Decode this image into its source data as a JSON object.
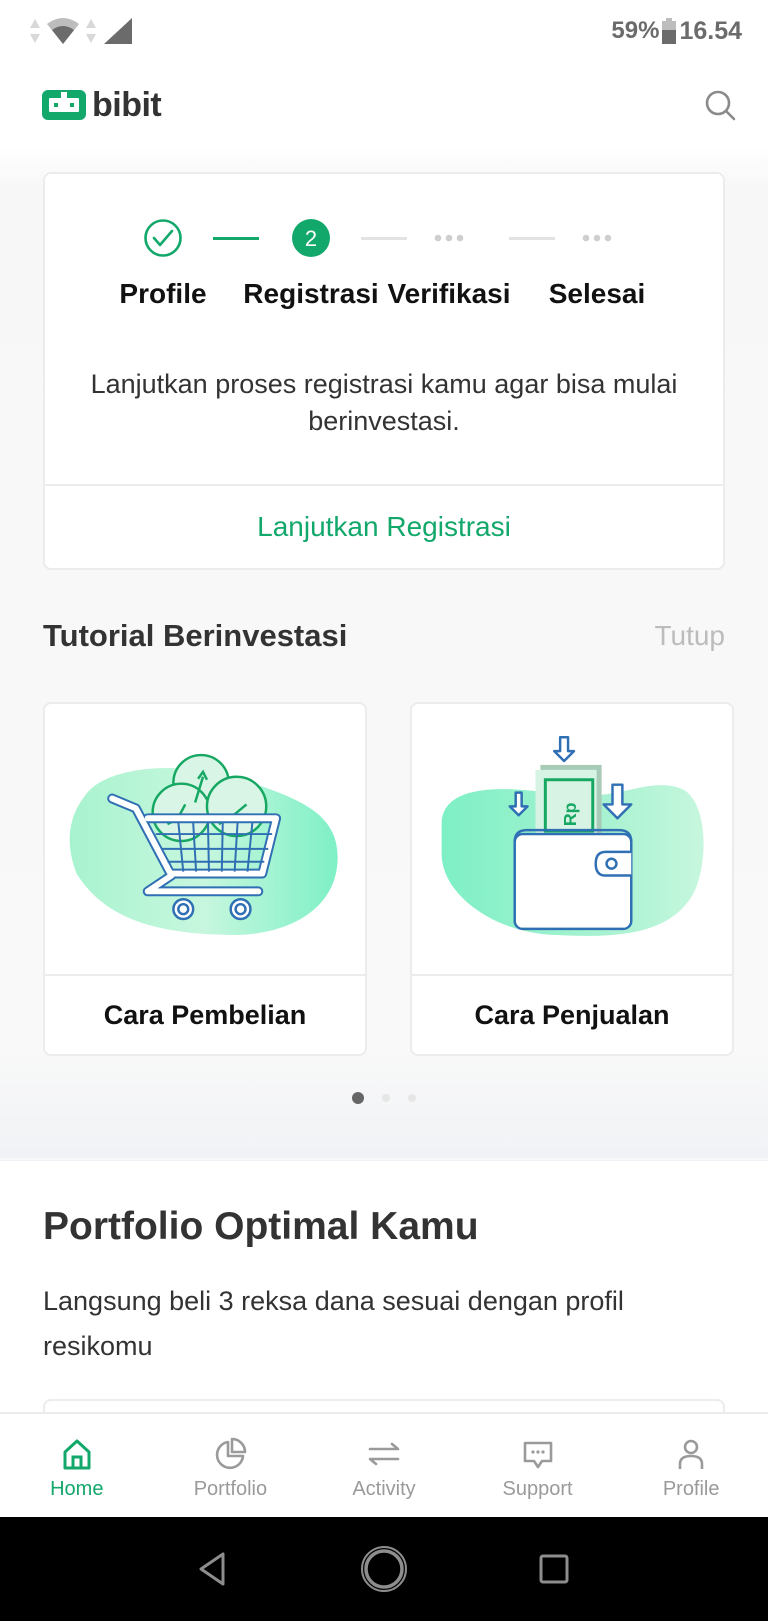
{
  "status_bar": {
    "battery_percent": "59%",
    "time": "16.54",
    "icons": [
      "data-arrows-icon",
      "wifi-icon",
      "data-arrows-icon",
      "signal-icon",
      "battery-icon"
    ]
  },
  "header": {
    "app_name": "bibit",
    "search_icon": "search-icon"
  },
  "registration": {
    "steps": [
      {
        "label": "Profile",
        "state": "done",
        "icon": "check-circle-icon"
      },
      {
        "label": "Registrasi",
        "state": "current",
        "number": "2"
      },
      {
        "label": "Verifikasi",
        "state": "pending",
        "icon": "dots-icon"
      },
      {
        "label": "Selesai",
        "state": "pending",
        "icon": "dots-icon"
      }
    ],
    "description": "Lanjutkan proses registrasi kamu agar bisa mulai berinvestasi.",
    "cta_label": "Lanjutkan Registrasi"
  },
  "tutorial": {
    "title": "Tutorial Berinvestasi",
    "close_label": "Tutup",
    "cards": [
      {
        "label": "Cara Pembelian",
        "illustration": "shopping-cart-illustration"
      },
      {
        "label": "Cara Penjualan",
        "illustration": "wallet-illustration",
        "currency_text": "Rp"
      }
    ],
    "pager": {
      "total": 3,
      "active_index": 0
    }
  },
  "portfolio": {
    "title": "Portfolio Optimal Kamu",
    "description": "Langsung beli 3 reksa dana sesuai dengan profil resikomu"
  },
  "bottom_nav": {
    "items": [
      {
        "label": "Home",
        "icon": "home-icon",
        "active": true
      },
      {
        "label": "Portfolio",
        "icon": "pie-chart-icon",
        "active": false
      },
      {
        "label": "Activity",
        "icon": "swap-arrows-icon",
        "active": false
      },
      {
        "label": "Support",
        "icon": "chat-bubble-icon",
        "active": false
      },
      {
        "label": "Profile",
        "icon": "person-icon",
        "active": false
      }
    ]
  },
  "system_nav": {
    "buttons": [
      "back-icon",
      "home-circle-icon",
      "recents-icon"
    ]
  },
  "colors": {
    "brand_green": "#13a86b",
    "text_dark": "#333333",
    "muted": "#9a9a9a",
    "illustration_blue": "#2f6fb3"
  }
}
